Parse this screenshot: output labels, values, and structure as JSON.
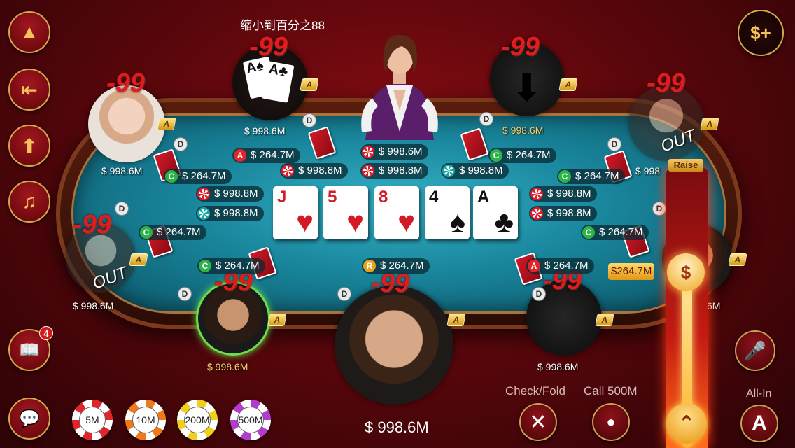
{
  "header": {
    "zoom_text": "缩小到百分之88"
  },
  "sidebar": {
    "buttons": [
      {
        "name": "up-arrow",
        "glyph": "▲"
      },
      {
        "name": "exit",
        "glyph": "⇤"
      },
      {
        "name": "stand-up",
        "glyph": "⬆"
      },
      {
        "name": "mute-music",
        "glyph": "♫"
      },
      {
        "name": "help-book",
        "glyph": "📖",
        "badge": "4"
      },
      {
        "name": "chat",
        "glyph": "💬"
      }
    ]
  },
  "topright": {
    "glyph": "$+"
  },
  "community_cards": [
    {
      "rank": "J",
      "suit": "♥",
      "color": "red"
    },
    {
      "rank": "5",
      "suit": "♥",
      "color": "red"
    },
    {
      "rank": "8",
      "suit": "♥",
      "color": "red"
    },
    {
      "rank": "4",
      "suit": "♠",
      "color": "blk"
    },
    {
      "rank": "A",
      "suit": "♣",
      "color": "blk"
    }
  ],
  "players": {
    "p_left_top": {
      "score": "-99",
      "money": "$ 998.6M",
      "level": "A"
    },
    "p_cards": {
      "score": "-99",
      "money": "$ 998.6M",
      "level": "A"
    },
    "p_top_right_empty": {
      "score": "-99",
      "money": "$ 998.6M",
      "level": "A"
    },
    "p_right_top": {
      "score": "-99",
      "money": "$ 998",
      "out": "OUT",
      "level": "A"
    },
    "p_left_mid": {
      "score": "-99",
      "money": "$ 998.6M",
      "out": "OUT",
      "level": "A"
    },
    "p_bottom_left": {
      "score": "-99",
      "money": "$ 998.6M",
      "level": "A"
    },
    "p_me": {
      "score": "-99",
      "money": "$ 998.6M",
      "level": "A"
    },
    "p_bottom_right_empty": {
      "score": "-99",
      "money": "$ 998.6M",
      "level": "A"
    },
    "p_right_mid": {
      "money": "6M",
      "level": "A"
    }
  },
  "bets": {
    "top_center": "$ 998.6M",
    "a_top": "$ 264.7M",
    "c_top_right": "$ 264.7M",
    "b1": "$ 998.8M",
    "b2": "$ 998.8M",
    "b3": "$ 998.8M",
    "c_left_top": "$ 264.7M",
    "c_right_top": "$ 264.7M",
    "l1": "$ 998.8M",
    "l2": "$ 998.8M",
    "r1": "$ 998.8M",
    "r2": "$ 998.8M",
    "c_left_mid": "$ 264.7M",
    "c_right_mid": "$ 264.7M",
    "c_bottom_left": "$ 264.7M",
    "r_bottom": "$ 264.7M",
    "a_bottom_right": "$ 264.7M"
  },
  "bet_markers": {
    "A": "A",
    "C": "C",
    "R": "R",
    "D": "D"
  },
  "raise": {
    "label": "Raise",
    "value": "$264.7M",
    "knob": "$",
    "up": "⌃"
  },
  "actions": {
    "check_fold": "Check/Fold",
    "call": "Call 500M",
    "all_in": "All-In",
    "fold_glyph": "✕",
    "check_glyph": "●",
    "allin_glyph": "A",
    "mic_glyph": "🎤"
  },
  "chips": [
    "5M",
    "10M",
    "200M",
    "500M"
  ],
  "my_balance": "$ 998.6M",
  "colors": {
    "chip_5m": "#e0262b",
    "chip_10m": "#f07a1a",
    "chip_200m": "#f2cf1a",
    "chip_500m": "#b43ad0"
  }
}
